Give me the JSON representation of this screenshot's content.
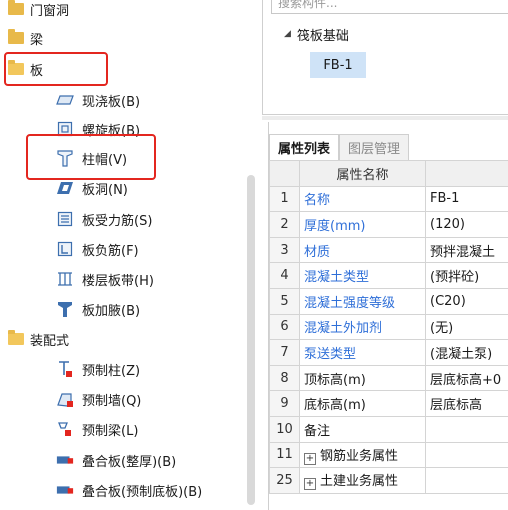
{
  "tree": {
    "items": [
      {
        "label": "门窗洞",
        "icon": "folder-icon"
      },
      {
        "label": "梁",
        "icon": "folder-icon"
      },
      {
        "label": "板",
        "icon": "folder-open-icon"
      },
      {
        "label": "现浇板(B)",
        "icon": "slab-icon"
      },
      {
        "label": "螺旋板(B)",
        "icon": "spiral-slab-icon"
      },
      {
        "label": "柱帽(V)",
        "icon": "column-cap-icon"
      },
      {
        "label": "板洞(N)",
        "icon": "slab-hole-icon"
      },
      {
        "label": "板受力筋(S)",
        "icon": "slab-rebar-icon"
      },
      {
        "label": "板负筋(F)",
        "icon": "negative-rebar-icon"
      },
      {
        "label": "楼层板带(H)",
        "icon": "floor-strip-icon"
      },
      {
        "label": "板加腋(B)",
        "icon": "slab-haunch-icon"
      },
      {
        "label": "装配式",
        "icon": "folder-open-icon"
      },
      {
        "label": "预制柱(Z)",
        "icon": "precast-column-icon"
      },
      {
        "label": "预制墙(Q)",
        "icon": "precast-wall-icon"
      },
      {
        "label": "预制梁(L)",
        "icon": "precast-beam-icon"
      },
      {
        "label": "叠合板(整厚)(B)",
        "icon": "composite-slab-icon"
      },
      {
        "label": "叠合板(预制底板)(B)",
        "icon": "composite-bottom-slab-icon"
      }
    ]
  },
  "component_tree": {
    "search_placeholder": "搜索构件...",
    "node": "筏板基础",
    "child": "FB-1"
  },
  "properties": {
    "tabs": [
      "属性列表",
      "图层管理"
    ],
    "column_header": "属性名称",
    "rows": [
      {
        "num": "1",
        "name": "名称",
        "value": "FB-1",
        "blue": true
      },
      {
        "num": "2",
        "name": "厚度(mm)",
        "value": "(120)",
        "blue": true
      },
      {
        "num": "3",
        "name": "材质",
        "value": "预拌混凝土",
        "blue": true
      },
      {
        "num": "4",
        "name": "混凝土类型",
        "value": "(预拌砼)",
        "blue": true
      },
      {
        "num": "5",
        "name": "混凝土强度等级",
        "value": "(C20)",
        "blue": true
      },
      {
        "num": "6",
        "name": "混凝土外加剂",
        "value": "(无)",
        "blue": true
      },
      {
        "num": "7",
        "name": "泵送类型",
        "value": "(混凝土泵)",
        "blue": true
      },
      {
        "num": "8",
        "name": "顶标高(m)",
        "value": "层底标高+0",
        "blue": false
      },
      {
        "num": "9",
        "name": "底标高(m)",
        "value": "层底标高",
        "blue": false
      },
      {
        "num": "10",
        "name": "备注",
        "value": "",
        "blue": false
      },
      {
        "num": "11",
        "name": "钢筋业务属性",
        "value": "",
        "blue": false,
        "expand": "+"
      },
      {
        "num": "25",
        "name": "土建业务属性",
        "value": "",
        "blue": false,
        "expand": "+"
      }
    ]
  },
  "colors": {
    "highlight": "#e3261f",
    "link": "#2f6fd8",
    "selected": "#cfe3f7"
  }
}
